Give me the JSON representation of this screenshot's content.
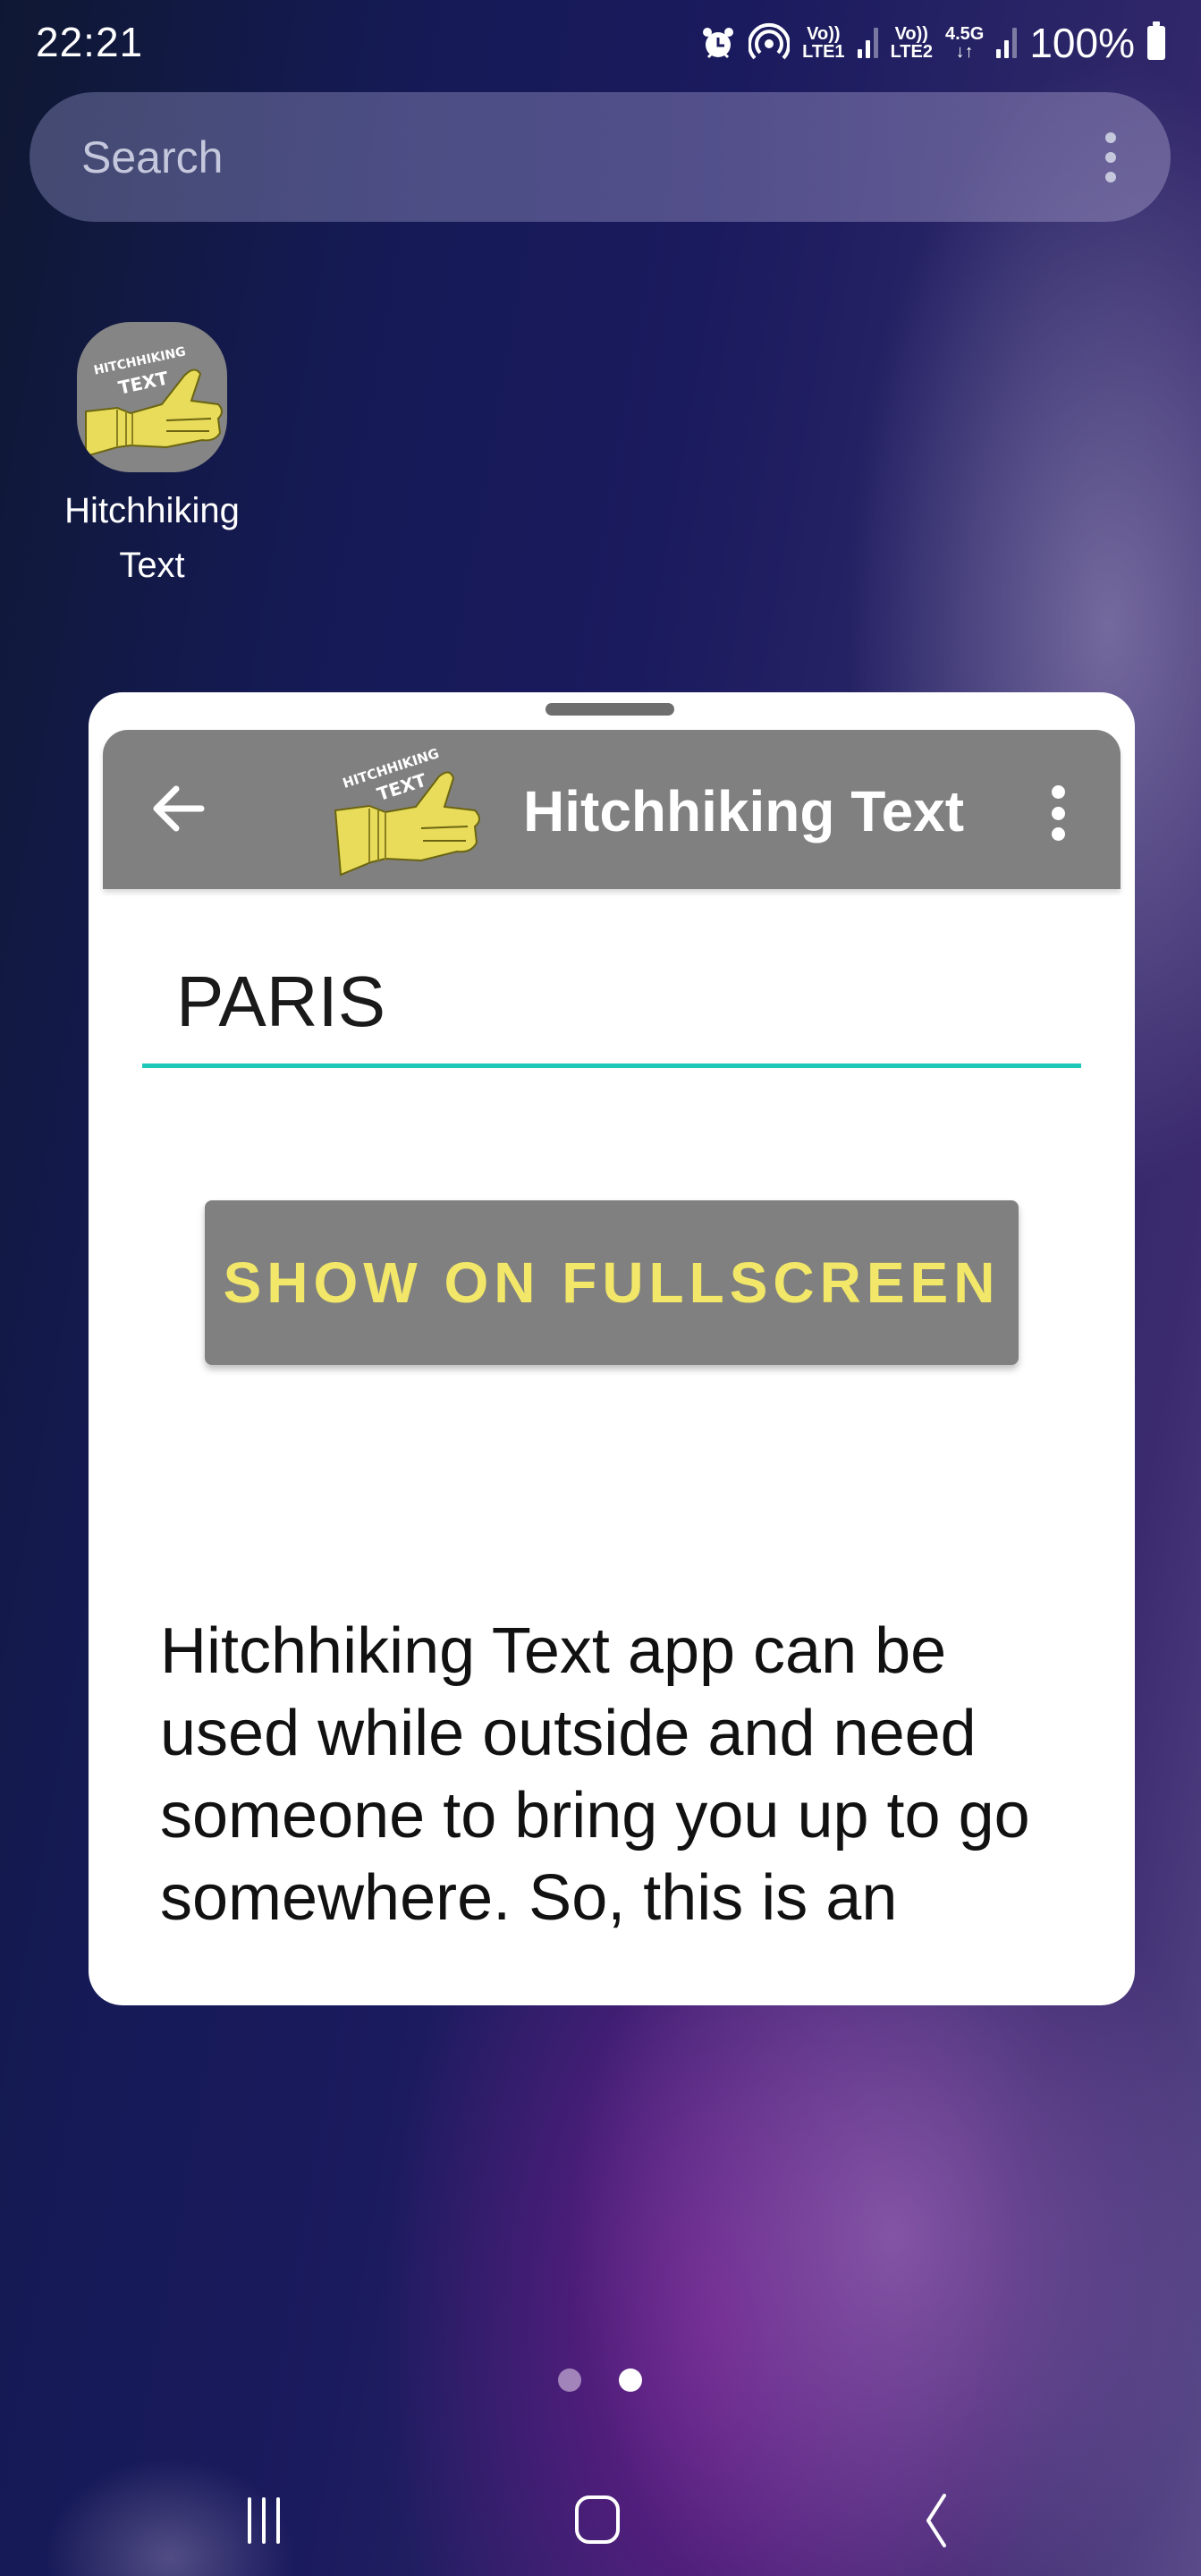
{
  "status_bar": {
    "time": "22:21",
    "icons": [
      "alarm-icon",
      "hotspot-icon",
      "volte-lte1-icon",
      "signal-sim1-icon",
      "volte-lte2-icon",
      "network-4-5g-icon",
      "signal-sim2-icon",
      "battery-icon"
    ],
    "sim1_line1": "Vo))",
    "sim1_line2": "LTE1",
    "sim2_line1": "Vo))",
    "sim2_line2": "LTE2",
    "network_type": "4.5G",
    "data_arrows": "↓↑",
    "battery_percent": "100%"
  },
  "search_bar": {
    "placeholder": "Search",
    "menu_icon": "more-vert-icon"
  },
  "home_shortcut": {
    "label_line1": "Hitchhiking",
    "label_line2": "Text",
    "icon_line1": "HITCHHIKING",
    "icon_line2": "TEXT"
  },
  "popup_app": {
    "toolbar": {
      "back_icon": "arrow-back-icon",
      "logo_line1": "HITCHHIKING",
      "logo_line2": "TEXT",
      "title": "Hitchhiking Text",
      "menu_icon": "more-vert-icon",
      "color": "#808080"
    },
    "text_field": {
      "value": "PARIS",
      "underline_color": "#1ec8b8"
    },
    "fullscreen_button": {
      "label": "SHOW ON FULLSCREEN",
      "text_color": "#f2e768",
      "bg_color": "#808080"
    },
    "description": "Hitchhiking Text app can be used while outside and need someone to bring you up to go somewhere. So, this is an"
  },
  "page_indicator": {
    "total_pages": 2,
    "current_page": 2
  },
  "nav_bar": {
    "recents_icon": "recent-apps-icon",
    "home_icon": "home-icon",
    "back_icon": "back-icon"
  }
}
